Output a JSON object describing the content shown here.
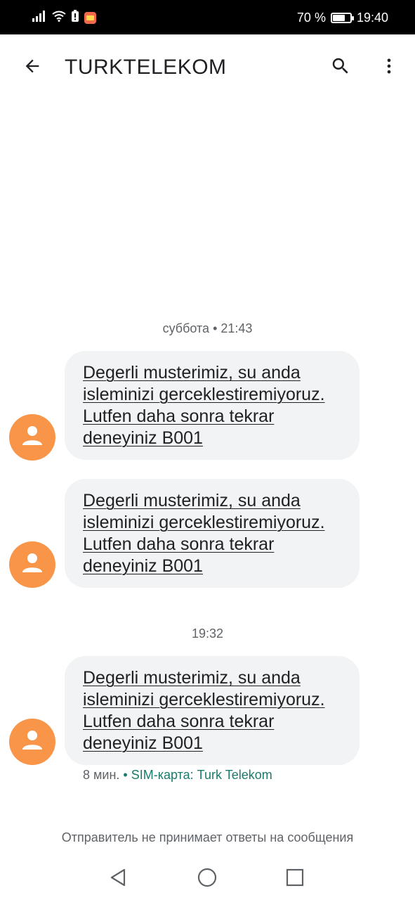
{
  "status_bar": {
    "battery_percent_text": "70 %",
    "battery_level": 0.7,
    "time": "19:40",
    "icons": [
      "signal-icon",
      "wifi-icon",
      "battery-alert-icon",
      "mail-notification-icon",
      "battery-icon"
    ]
  },
  "app_bar": {
    "title": "TURKTELEKOM",
    "back_icon": "arrow-back-icon",
    "search_icon": "search-icon",
    "more_icon": "more-vert-icon"
  },
  "conversation": {
    "groups": [
      {
        "date_label": "суббота • 21:43",
        "messages": [
          {
            "text": "Degerli musterimiz, su anda isleminizi gerceklestiremiyoruz. Lutfen daha sonra tekrar deneyiniz B001"
          },
          {
            "text": "Degerli musterimiz, su anda isleminizi gerceklestiremiyoruz. Lutfen daha sonra tekrar deneyiniz B001"
          }
        ]
      },
      {
        "date_label": "19:32",
        "messages": [
          {
            "text": "Degerli musterimiz, su anda isleminizi gerceklestiremiyoruz. Lutfen daha sonra tekrar deneyiniz B001"
          }
        ]
      }
    ],
    "last_message_meta": {
      "age": "8 мин.",
      "separator": "•",
      "sim": "SIM-карта: Turk Telekom"
    }
  },
  "footer_note": "Отправитель не принимает ответы на сообщения",
  "nav_bar": {
    "icons": [
      "nav-back-icon",
      "nav-home-icon",
      "nav-recents-icon"
    ]
  },
  "colors": {
    "avatar": "#f99548",
    "bubble": "#f1f3f4",
    "sim_label": "#1a7a6c",
    "secondary_text": "#5f6368"
  }
}
